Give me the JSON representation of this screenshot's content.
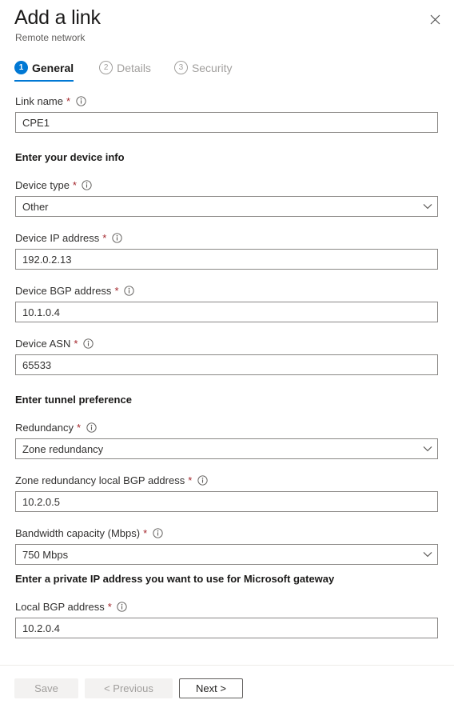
{
  "header": {
    "title": "Add a link",
    "subtitle": "Remote network",
    "close_icon": "close-icon"
  },
  "tabs": [
    {
      "num": "1",
      "label": "General",
      "state": "active"
    },
    {
      "num": "2",
      "label": "Details",
      "state": "inactive"
    },
    {
      "num": "3",
      "label": "Security",
      "state": "inactive"
    }
  ],
  "form": {
    "link_name": {
      "label": "Link name",
      "required": "*",
      "info_icon": "info-icon",
      "value": "CPE1"
    },
    "device_section": {
      "heading": "Enter your device info"
    },
    "device_type": {
      "label": "Device type",
      "required": "*",
      "info_icon": "info-icon",
      "value": "Other",
      "chevron_icon": "chevron-down-icon"
    },
    "device_ip": {
      "label": "Device IP address",
      "required": "*",
      "info_icon": "info-icon",
      "value": "192.0.2.13"
    },
    "device_bgp": {
      "label": "Device BGP address",
      "required": "*",
      "info_icon": "info-icon",
      "value": "10.1.0.4"
    },
    "device_asn": {
      "label": "Device ASN",
      "required": "*",
      "info_icon": "info-icon",
      "value": "65533"
    },
    "tunnel_section": {
      "heading": "Enter tunnel preference"
    },
    "redundancy": {
      "label": "Redundancy",
      "required": "*",
      "info_icon": "info-icon",
      "value": "Zone redundancy",
      "chevron_icon": "chevron-down-icon"
    },
    "zone_local_bgp": {
      "label": "Zone redundancy local BGP address",
      "required": "*",
      "info_icon": "info-icon",
      "value": "10.2.0.5"
    },
    "bandwidth": {
      "label": "Bandwidth capacity (Mbps)",
      "required": "*",
      "info_icon": "info-icon",
      "value": "750 Mbps",
      "chevron_icon": "chevron-down-icon"
    },
    "gateway_section": {
      "heading": "Enter a private IP address you want to use for Microsoft gateway"
    },
    "local_bgp": {
      "label": "Local BGP address",
      "required": "*",
      "info_icon": "info-icon",
      "value": "10.2.0.4"
    }
  },
  "footer": {
    "save_label": "Save",
    "previous_label": "< Previous",
    "next_label": "Next >"
  },
  "colors": {
    "accent": "#0078d4",
    "required_asterisk": "#a4262c",
    "text_primary": "#1b1a19",
    "text_secondary": "#605e5c",
    "text_disabled": "#a19f9d",
    "border": "#8a8886",
    "divider": "#edebe9",
    "disabled_bg": "#f3f2f1"
  }
}
